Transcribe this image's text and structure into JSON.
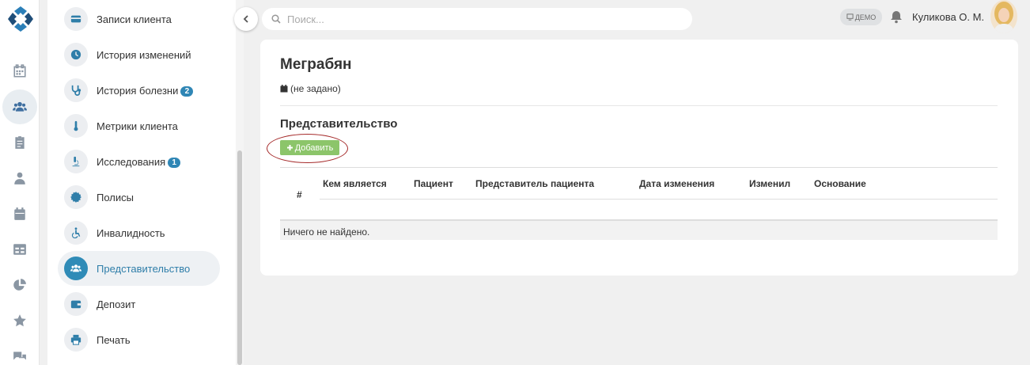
{
  "sidebar": {
    "items": [
      {
        "label": "Записи клиента",
        "icon": "card-icon"
      },
      {
        "label": "История изменений",
        "icon": "clock-icon"
      },
      {
        "label": "История болезни",
        "icon": "stethoscope-icon",
        "count": "2"
      },
      {
        "label": "Метрики клиента",
        "icon": "thermometer-icon"
      },
      {
        "label": "Исследования",
        "icon": "microscope-icon",
        "count": "1"
      },
      {
        "label": "Полисы",
        "icon": "certificate-icon"
      },
      {
        "label": "Инвалидность",
        "icon": "wheelchair-icon"
      },
      {
        "label": "Представительство",
        "icon": "users-icon",
        "active": true
      },
      {
        "label": "Депозит",
        "icon": "wallet-icon"
      },
      {
        "label": "Печать",
        "icon": "printer-icon"
      }
    ]
  },
  "search": {
    "placeholder": "Поиск..."
  },
  "header": {
    "demo_label": "ДЕМО",
    "user_name": "Куликова О. М."
  },
  "client": {
    "name": "Меграбян",
    "birth_date": "(не задано)"
  },
  "section": {
    "title": "Представительство",
    "add_label": "Добавить"
  },
  "table": {
    "columns": [
      "#",
      "Кем является",
      "Пациент",
      "Представитель пациента",
      "Дата изменения",
      "Изменил",
      "Основание"
    ],
    "empty_text": "Ничего не найдено."
  },
  "colors": {
    "accent": "#2f8bb7",
    "add_button": "#8cc56a",
    "highlight_ring": "#a52a2a"
  }
}
